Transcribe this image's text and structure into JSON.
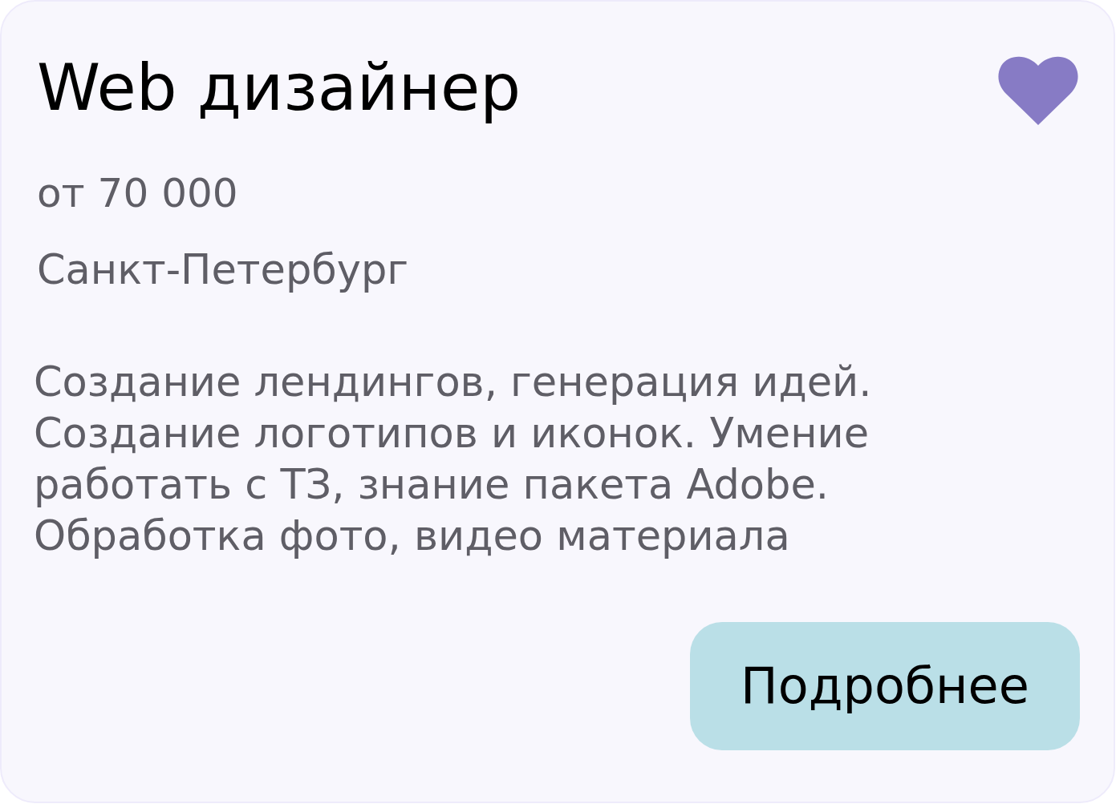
{
  "card": {
    "title": "Web дизайнер",
    "favorited": true,
    "salary": "от 70 000",
    "city": "Санкт-Петербург",
    "description": "Создание лендингов, генерация идей. Создание логотипов и иконок. Умение работать с ТЗ, знание пакета Adobe. Обработка фото, видео материала",
    "button": "Подробнее"
  }
}
